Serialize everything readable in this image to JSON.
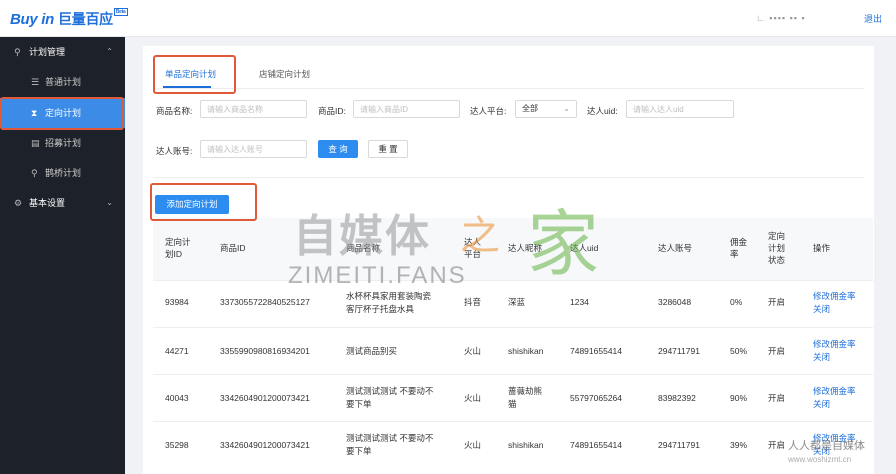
{
  "header": {
    "logo_en": "Buy in",
    "logo_cn": "巨量百应",
    "logo_badge": "Beta",
    "user_masked": "∟ ▪▪▪▪ ▪▪ ▪",
    "logout": "退出"
  },
  "sidebar": {
    "group_plan": {
      "label": "计划管理",
      "icon": "megaphone-icon"
    },
    "items": [
      {
        "label": "普通计划",
        "icon": "list-icon"
      },
      {
        "label": "定向计划",
        "icon": "hourglass-icon"
      },
      {
        "label": "招募计划",
        "icon": "document-icon"
      },
      {
        "label": "鹊桥计划",
        "icon": "bridge-icon"
      }
    ],
    "group_settings": {
      "label": "基本设置",
      "icon": "gear-icon"
    }
  },
  "tabs": [
    "单品定向计划",
    "店铺定向计划"
  ],
  "filters": {
    "product_name": {
      "label": "商品名称:",
      "placeholder": "请输入商品名称"
    },
    "product_id": {
      "label": "商品ID:",
      "placeholder": "请输入商品ID"
    },
    "platform": {
      "label": "达人平台:",
      "value": "全部"
    },
    "uid": {
      "label": "达人uid:",
      "placeholder": "请输入达人uid"
    },
    "account": {
      "label": "达人账号:",
      "placeholder": "请输入达人账号"
    },
    "search_btn": "查 询",
    "reset_btn": "重 置"
  },
  "add_button": "添加定向计划",
  "table": {
    "headers": {
      "plan_id": "定向计划ID",
      "product_id": "商品ID",
      "product_name": "商品名称",
      "platform": "达人平台",
      "nickname": "达人昵称",
      "uid": "达人uid",
      "account": "达人账号",
      "commission": "佣金率",
      "status": "定向计划状态",
      "ops": "操作"
    },
    "rows": [
      {
        "plan_id": "93984",
        "product_id": "3373055722840525127",
        "product_name": "水杯杯具家用套装陶瓷客厅杯子托盘水具",
        "platform": "抖音",
        "nickname": "深蓝",
        "uid": "1234",
        "account": "3286048",
        "commission": "0%",
        "status": "开启",
        "op1": "修改佣金率",
        "op2": "关闭"
      },
      {
        "plan_id": "44271",
        "product_id": "3355990980816934201",
        "product_name": "测试商品别买",
        "platform": "火山",
        "nickname": "shishikan",
        "uid": "74891655414",
        "account": "294711791",
        "commission": "50%",
        "status": "开启",
        "op1": "修改佣金率",
        "op2": "关闭"
      },
      {
        "plan_id": "40043",
        "product_id": "3342604901200073421",
        "product_name": "测试测试测试 不要动不要下单",
        "platform": "火山",
        "nickname": "蔷薇劫熊猫",
        "uid": "55797065264",
        "account": "83982392",
        "commission": "90%",
        "status": "开启",
        "op1": "修改佣金率",
        "op2": "关闭"
      },
      {
        "plan_id": "35298",
        "product_id": "3342604901200073421",
        "product_name": "测试测试测试 不要动不要下单",
        "platform": "火山",
        "nickname": "shishikan",
        "uid": "74891655414",
        "account": "294711791",
        "commission": "39%",
        "status": "开启",
        "op1": "修改佣金率",
        "op2": "关闭"
      }
    ]
  },
  "watermark": {
    "big": "自媒体",
    "zhi": "之",
    "jia": "家",
    "sub": "ZIMEITI.FANS",
    "corner": "人人都是自媒体",
    "corner_sub": "www.woshizmt.cn"
  },
  "colors": {
    "accent": "#1e6fd9",
    "sidebar_bg": "#1d2129",
    "active": "#3c8ce7",
    "highlight_box": "#e05a3a"
  }
}
